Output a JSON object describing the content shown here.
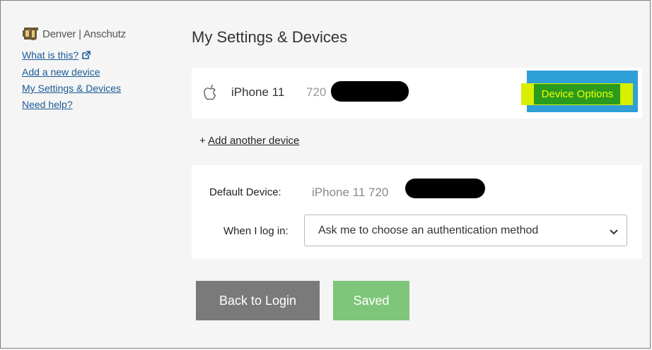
{
  "sidebar": {
    "brand": "Denver | Anschutz",
    "links": [
      "What is this?",
      "Add a new device",
      "My Settings & Devices",
      "Need help?"
    ]
  },
  "main": {
    "title": "My Settings & Devices",
    "device": {
      "name": "iPhone 11",
      "number": "720",
      "icon": "apple-icon"
    },
    "device_options_label": "Device Options",
    "add_prefix": "+",
    "add_link": "Add another device",
    "settings": {
      "default_label": "Default Device:",
      "default_value": "iPhone 11 720",
      "login_label": "When I log in:",
      "login_value": "Ask me to choose an authentication method"
    },
    "back_label": "Back to Login",
    "saved_label": "Saved"
  },
  "colors": {
    "link": "#1a5a96",
    "device_options_bg": "#2f9fd8",
    "highlight": "#d8f000",
    "back_bg": "#7a7a7a",
    "saved_bg": "#7ec67a"
  }
}
